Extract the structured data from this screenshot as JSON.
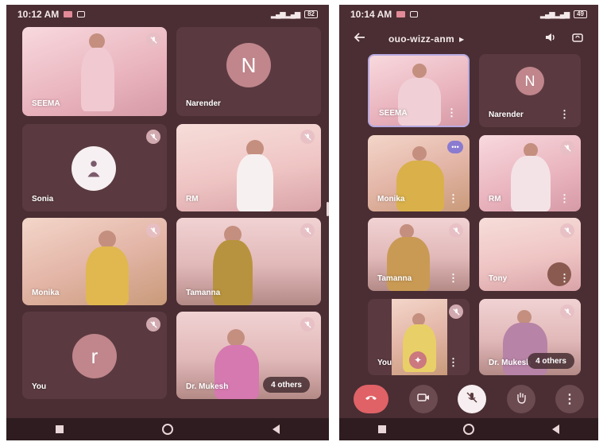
{
  "left_phone": {
    "status": {
      "time": "10:12 AM",
      "battery": "82"
    },
    "tiles": [
      {
        "name": "SEEMA"
      },
      {
        "name": "Narender",
        "initial": "N"
      },
      {
        "name": "Sonia"
      },
      {
        "name": "RM"
      },
      {
        "name": "Monika"
      },
      {
        "name": "Tamanna"
      },
      {
        "name": "You",
        "initial": "r"
      },
      {
        "name": "Dr. Mukesh"
      }
    ],
    "others_label": "4 others"
  },
  "right_phone": {
    "status": {
      "time": "10:14 AM",
      "battery": "49"
    },
    "meeting_code": "ouo-wizz-anm",
    "tiles": [
      {
        "name": "SEEMA"
      },
      {
        "name": "Narender",
        "initial": "N"
      },
      {
        "name": "Monika"
      },
      {
        "name": "RM"
      },
      {
        "name": "Tamanna"
      },
      {
        "name": "Tony"
      },
      {
        "name": "You"
      },
      {
        "name": "Dr. Mukesh"
      }
    ],
    "others_label": "4 others"
  },
  "colors": {
    "background": "#4a2e33",
    "end_call": "#e06266",
    "avatar": "#c0868c",
    "speaker_ring": "#b7a9e0"
  },
  "icons": {
    "back": "arrow-left-icon",
    "audio": "speaker-icon",
    "camera_switch": "camera-switch-icon",
    "end_call": "phone-hangup-icon",
    "video": "video-camera-icon",
    "mic": "mic-off-icon",
    "hand": "raise-hand-icon",
    "more": "more-vertical-icon"
  }
}
